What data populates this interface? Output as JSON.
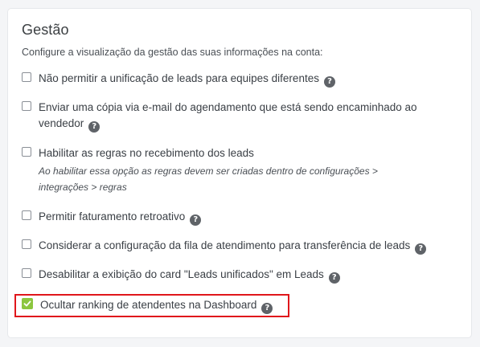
{
  "section": {
    "title": "Gestão",
    "subtitle": "Configure a visualização da gestão das suas informações na conta:"
  },
  "options": [
    {
      "line1": "Não permitir a unificação de leads para equipes diferentes",
      "checked": false
    },
    {
      "line1": "Enviar uma cópia via e-mail do agendamento que está sendo encaminhado ao",
      "line2": "vendedor",
      "checked": false
    },
    {
      "line1": "Habilitar as regras no recebimento dos leads",
      "hint1": "Ao habilitar essa opção as regras devem ser criadas dentro de configurações >",
      "hint2": "integrações > regras",
      "checked": false
    },
    {
      "line1": "Permitir faturamento retroativo",
      "checked": false
    },
    {
      "line1": "Considerar a configuração da fila de atendimento para transferência de leads",
      "checked": false
    },
    {
      "line1": "Desabilitar a exibição do card \"Leads unificados\" em Leads",
      "checked": false
    },
    {
      "line1": "Ocultar ranking de atendentes na Dashboard",
      "checked": true
    }
  ],
  "help_icon": {
    "name": "question-circle-icon",
    "glyph": "?"
  },
  "colors": {
    "checked": "#8cc63f",
    "highlight": "#e0161b",
    "help_bg": "#5f6368"
  }
}
